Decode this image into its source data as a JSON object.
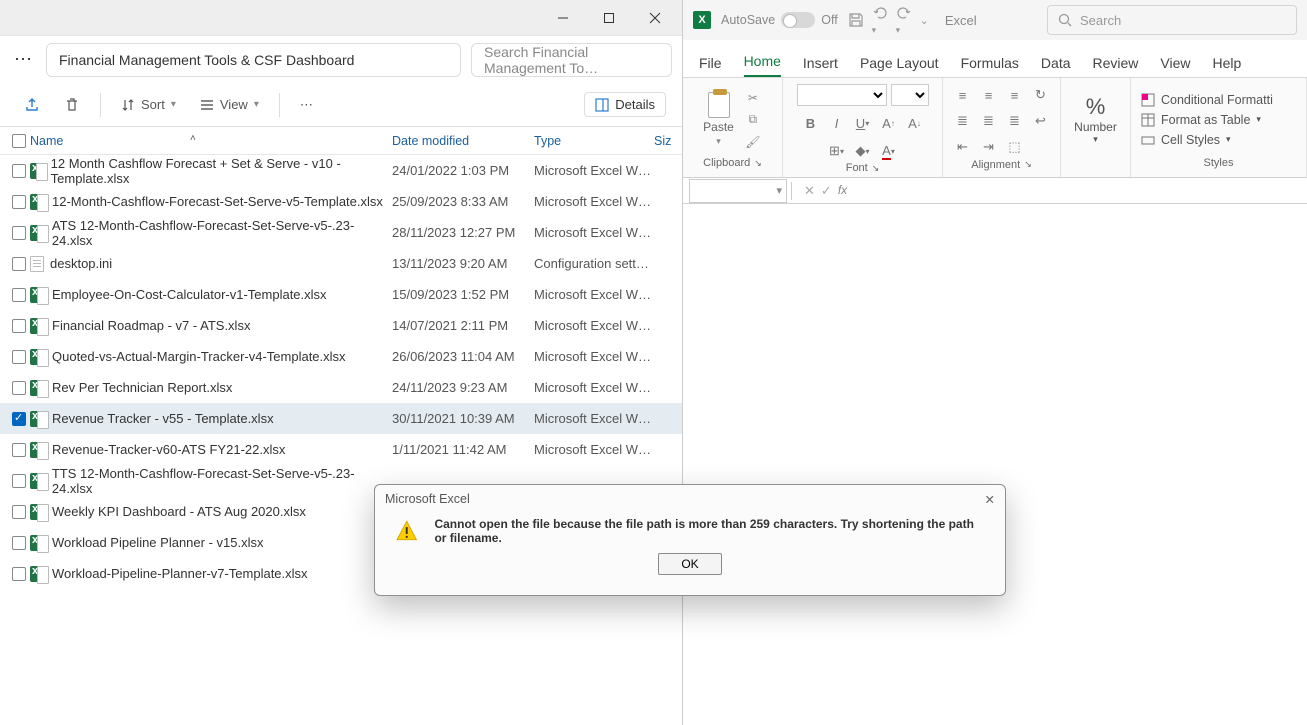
{
  "explorer": {
    "address": "Financial Management Tools & CSF Dashboard",
    "search_placeholder": "Search Financial Management To…",
    "toolbar": {
      "sort_label": "Sort",
      "view_label": "View",
      "details_label": "Details"
    },
    "columns": {
      "name": "Name",
      "date": "Date modified",
      "type": "Type",
      "size": "Siz"
    },
    "files": [
      {
        "name": "12 Month Cashflow Forecast + Set & Serve - v10 - Template.xlsx",
        "date": "24/01/2022 1:03 PM",
        "type": "Microsoft Excel W…",
        "icon": "xls",
        "selected": false
      },
      {
        "name": "12-Month-Cashflow-Forecast-Set-Serve-v5-Template.xlsx",
        "date": "25/09/2023 8:33 AM",
        "type": "Microsoft Excel W…",
        "icon": "xls",
        "selected": false
      },
      {
        "name": "ATS 12-Month-Cashflow-Forecast-Set-Serve-v5-.23-24.xlsx",
        "date": "28/11/2023 12:27 PM",
        "type": "Microsoft Excel W…",
        "icon": "xls",
        "selected": false
      },
      {
        "name": "desktop.ini",
        "date": "13/11/2023 9:20 AM",
        "type": "Configuration sett…",
        "icon": "ini",
        "selected": false
      },
      {
        "name": "Employee-On-Cost-Calculator-v1-Template.xlsx",
        "date": "15/09/2023 1:52 PM",
        "type": "Microsoft Excel W…",
        "icon": "xls",
        "selected": false
      },
      {
        "name": "Financial Roadmap - v7 - ATS.xlsx",
        "date": "14/07/2021 2:11 PM",
        "type": "Microsoft Excel W…",
        "icon": "xls",
        "selected": false
      },
      {
        "name": "Quoted-vs-Actual-Margin-Tracker-v4-Template.xlsx",
        "date": "26/06/2023 11:04 AM",
        "type": "Microsoft Excel W…",
        "icon": "xls",
        "selected": false
      },
      {
        "name": "Rev Per Technician Report.xlsx",
        "date": "24/11/2023 9:23 AM",
        "type": "Microsoft Excel W…",
        "icon": "xls",
        "selected": false
      },
      {
        "name": "Revenue Tracker - v55 - Template.xlsx",
        "date": "30/11/2021 10:39 AM",
        "type": "Microsoft Excel W…",
        "icon": "xls",
        "selected": true
      },
      {
        "name": "Revenue-Tracker-v60-ATS FY21-22.xlsx",
        "date": "1/11/2021 11:42 AM",
        "type": "Microsoft Excel W…",
        "icon": "xls",
        "selected": false
      },
      {
        "name": "TTS 12-Month-Cashflow-Forecast-Set-Serve-v5-.23-24.xlsx",
        "date": "",
        "type": "",
        "icon": "xls",
        "selected": false
      },
      {
        "name": "Weekly KPI Dashboard - ATS Aug 2020.xlsx",
        "date": "",
        "type": "",
        "icon": "xls",
        "selected": false
      },
      {
        "name": "Workload Pipeline Planner - v15.xlsx",
        "date": "",
        "type": "",
        "icon": "xls",
        "selected": false
      },
      {
        "name": "Workload-Pipeline-Planner-v7-Template.xlsx",
        "date": "",
        "type": "",
        "icon": "xls",
        "selected": false
      }
    ]
  },
  "excel": {
    "autosave_label": "AutoSave",
    "autosave_state": "Off",
    "app_name": "Excel",
    "search_placeholder": "Search",
    "tabs": [
      "File",
      "Home",
      "Insert",
      "Page Layout",
      "Formulas",
      "Data",
      "Review",
      "View",
      "Help"
    ],
    "active_tab": "Home",
    "groups": {
      "clipboard": "Clipboard",
      "paste": "Paste",
      "font": "Font",
      "alignment": "Alignment",
      "number": "Number",
      "styles": "Styles"
    },
    "styles_items": {
      "cond": "Conditional Formatti",
      "table": "Format as Table",
      "cell": "Cell Styles"
    }
  },
  "modal": {
    "title": "Microsoft Excel",
    "message": "Cannot open the file because the file path is more than 259 characters. Try shortening the path or filename.",
    "ok": "OK"
  }
}
